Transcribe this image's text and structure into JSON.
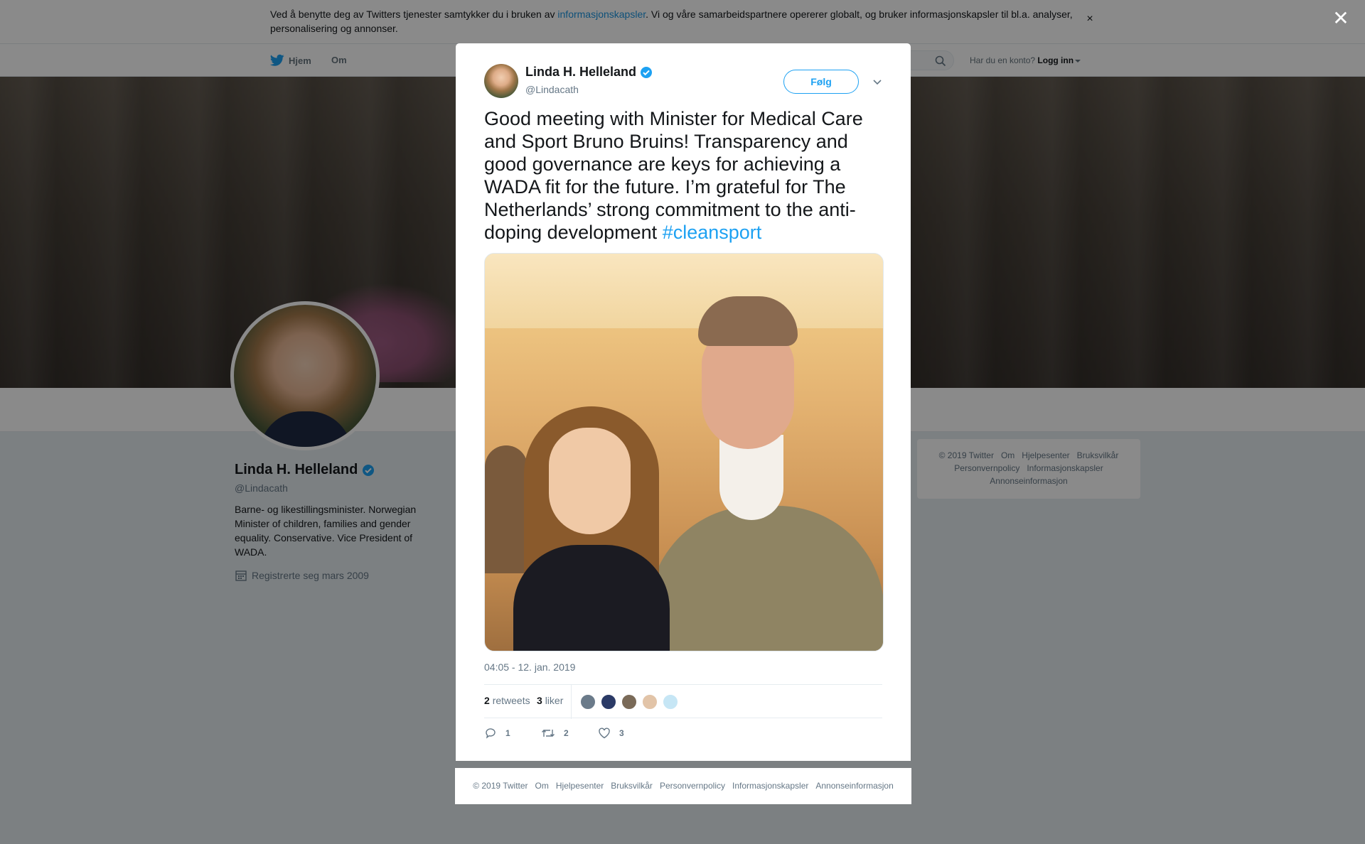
{
  "cookie_banner": {
    "text_before": "Ved å benytte deg av Twitters tjenester samtykker du i bruken av ",
    "link": "informasjonskapsler",
    "text_after": ". Vi og våre samarbeidspartnere opererer globalt, og bruker informasjonskapsler til bl.a. analyser, personalisering og annonser.",
    "close": "×"
  },
  "nav": {
    "home": "Hjem",
    "about": "Om",
    "login_prompt": "Har du en konto?",
    "login": "Logg inn"
  },
  "overlay": {
    "close": "✕"
  },
  "profile": {
    "name": "Linda H. Helleland",
    "handle": "@Lindacath",
    "bio": "Barne- og likestillingsminister. Norwegian Minister of children, families and gender equality. Conservative. Vice President of WADA.",
    "joined": "Registrerte seg mars 2009"
  },
  "side_footer": {
    "links": [
      "© 2019 Twitter",
      "Om",
      "Hjelpesenter",
      "Bruksvilkår",
      "Personvernpolicy",
      "Informasjonskapsler",
      "Annonseinformasjon"
    ]
  },
  "tweet": {
    "name": "Linda H. Helleland",
    "handle": "@Lindacath",
    "follow": "Følg",
    "text": "Good meeting with Minister for Medical Care and Sport Bruno Bruins! Transparency and good governance are keys for achieving a WADA fit for the future. I’m grateful for The Netherlands’ strong commitment to the anti-doping development ",
    "hashtag": "#cleansport",
    "time": "04:05 - 12. jan. 2019",
    "retweets_count": "2",
    "retweets_label": "retweets",
    "likes_count": "3",
    "likes_label": "liker",
    "reply_count": "1",
    "retweet_action_count": "2",
    "like_action_count": "3"
  },
  "modal_footer": {
    "links": [
      "© 2019 Twitter",
      "Om",
      "Hjelpesenter",
      "Bruksvilkår",
      "Personvernpolicy",
      "Informasjonskapsler",
      "Annonseinformasjon"
    ]
  },
  "colors": {
    "twitter_blue": "#1da1f2",
    "verified_blue": "#1da1f2",
    "secondary_text": "#657786"
  },
  "icons": [
    "twitter-bird-icon",
    "search-icon",
    "verified-badge-icon",
    "calendar-icon",
    "chevron-down-icon",
    "reply-icon",
    "retweet-icon",
    "heart-icon",
    "close-icon"
  ]
}
